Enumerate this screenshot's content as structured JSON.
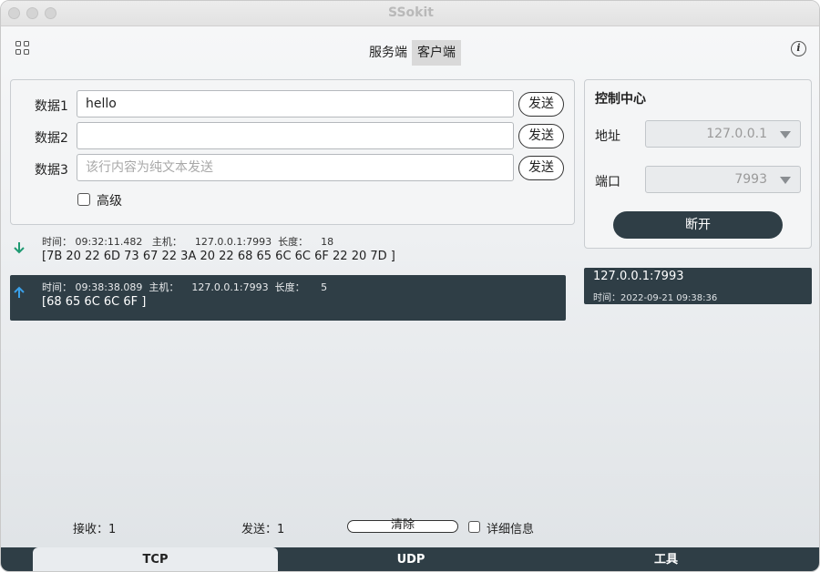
{
  "window": {
    "title": "SSokit"
  },
  "mode_tabs": {
    "server": "服务端",
    "client": "客户端"
  },
  "icons": {
    "apps": "grid-icon",
    "info": "info-icon",
    "info_glyph": "i"
  },
  "send_panel": {
    "rows": [
      {
        "label": "数据1",
        "value": "hello",
        "placeholder": ""
      },
      {
        "label": "数据2",
        "value": "",
        "placeholder": ""
      },
      {
        "label": "数据3",
        "value": "",
        "placeholder": "该行内容为纯文本发送"
      }
    ],
    "send_label": "发送",
    "advanced_label": "高级",
    "advanced_checked": false
  },
  "control_center": {
    "title": "控制中心",
    "address_label": "地址",
    "address_value": "127.0.0.1",
    "port_label": "端口",
    "port_value": "7993",
    "disconnect_label": "断开"
  },
  "log": [
    {
      "direction": "received",
      "meta_time_label": "时间：",
      "time": "09:32:11.482",
      "host_label": "主机：",
      "host": "127.0.0.1:7993",
      "length_label": "长度：",
      "length": "18",
      "data": "[7B 20 22 6D 73 67 22 3A 20 22 68 65 6C 6C 6F 22 20 7D ]"
    },
    {
      "direction": "sent",
      "meta_time_label": "时间：",
      "time": "09:38:38.089",
      "host_label": "主机：",
      "host": "127.0.0.1:7993",
      "length_label": "长度：",
      "length": "5",
      "data": "[68 65 6C 6C 6F ]"
    }
  ],
  "connections": [
    {
      "address": "127.0.0.1:7993",
      "time_label": "时间：",
      "time": "2022-09-21 09:38:36"
    }
  ],
  "footer": {
    "received": "接收：1",
    "sent": "发送：1",
    "clear_label": "清除",
    "details_label": "详细信息",
    "details_checked": false
  },
  "bottom_tabs": [
    "TCP",
    "UDP",
    "工具"
  ],
  "colors": {
    "accent_dark": "#2f3e46",
    "received_arrow": "#1f9a72",
    "sent_arrow": "#3aa0e8"
  }
}
